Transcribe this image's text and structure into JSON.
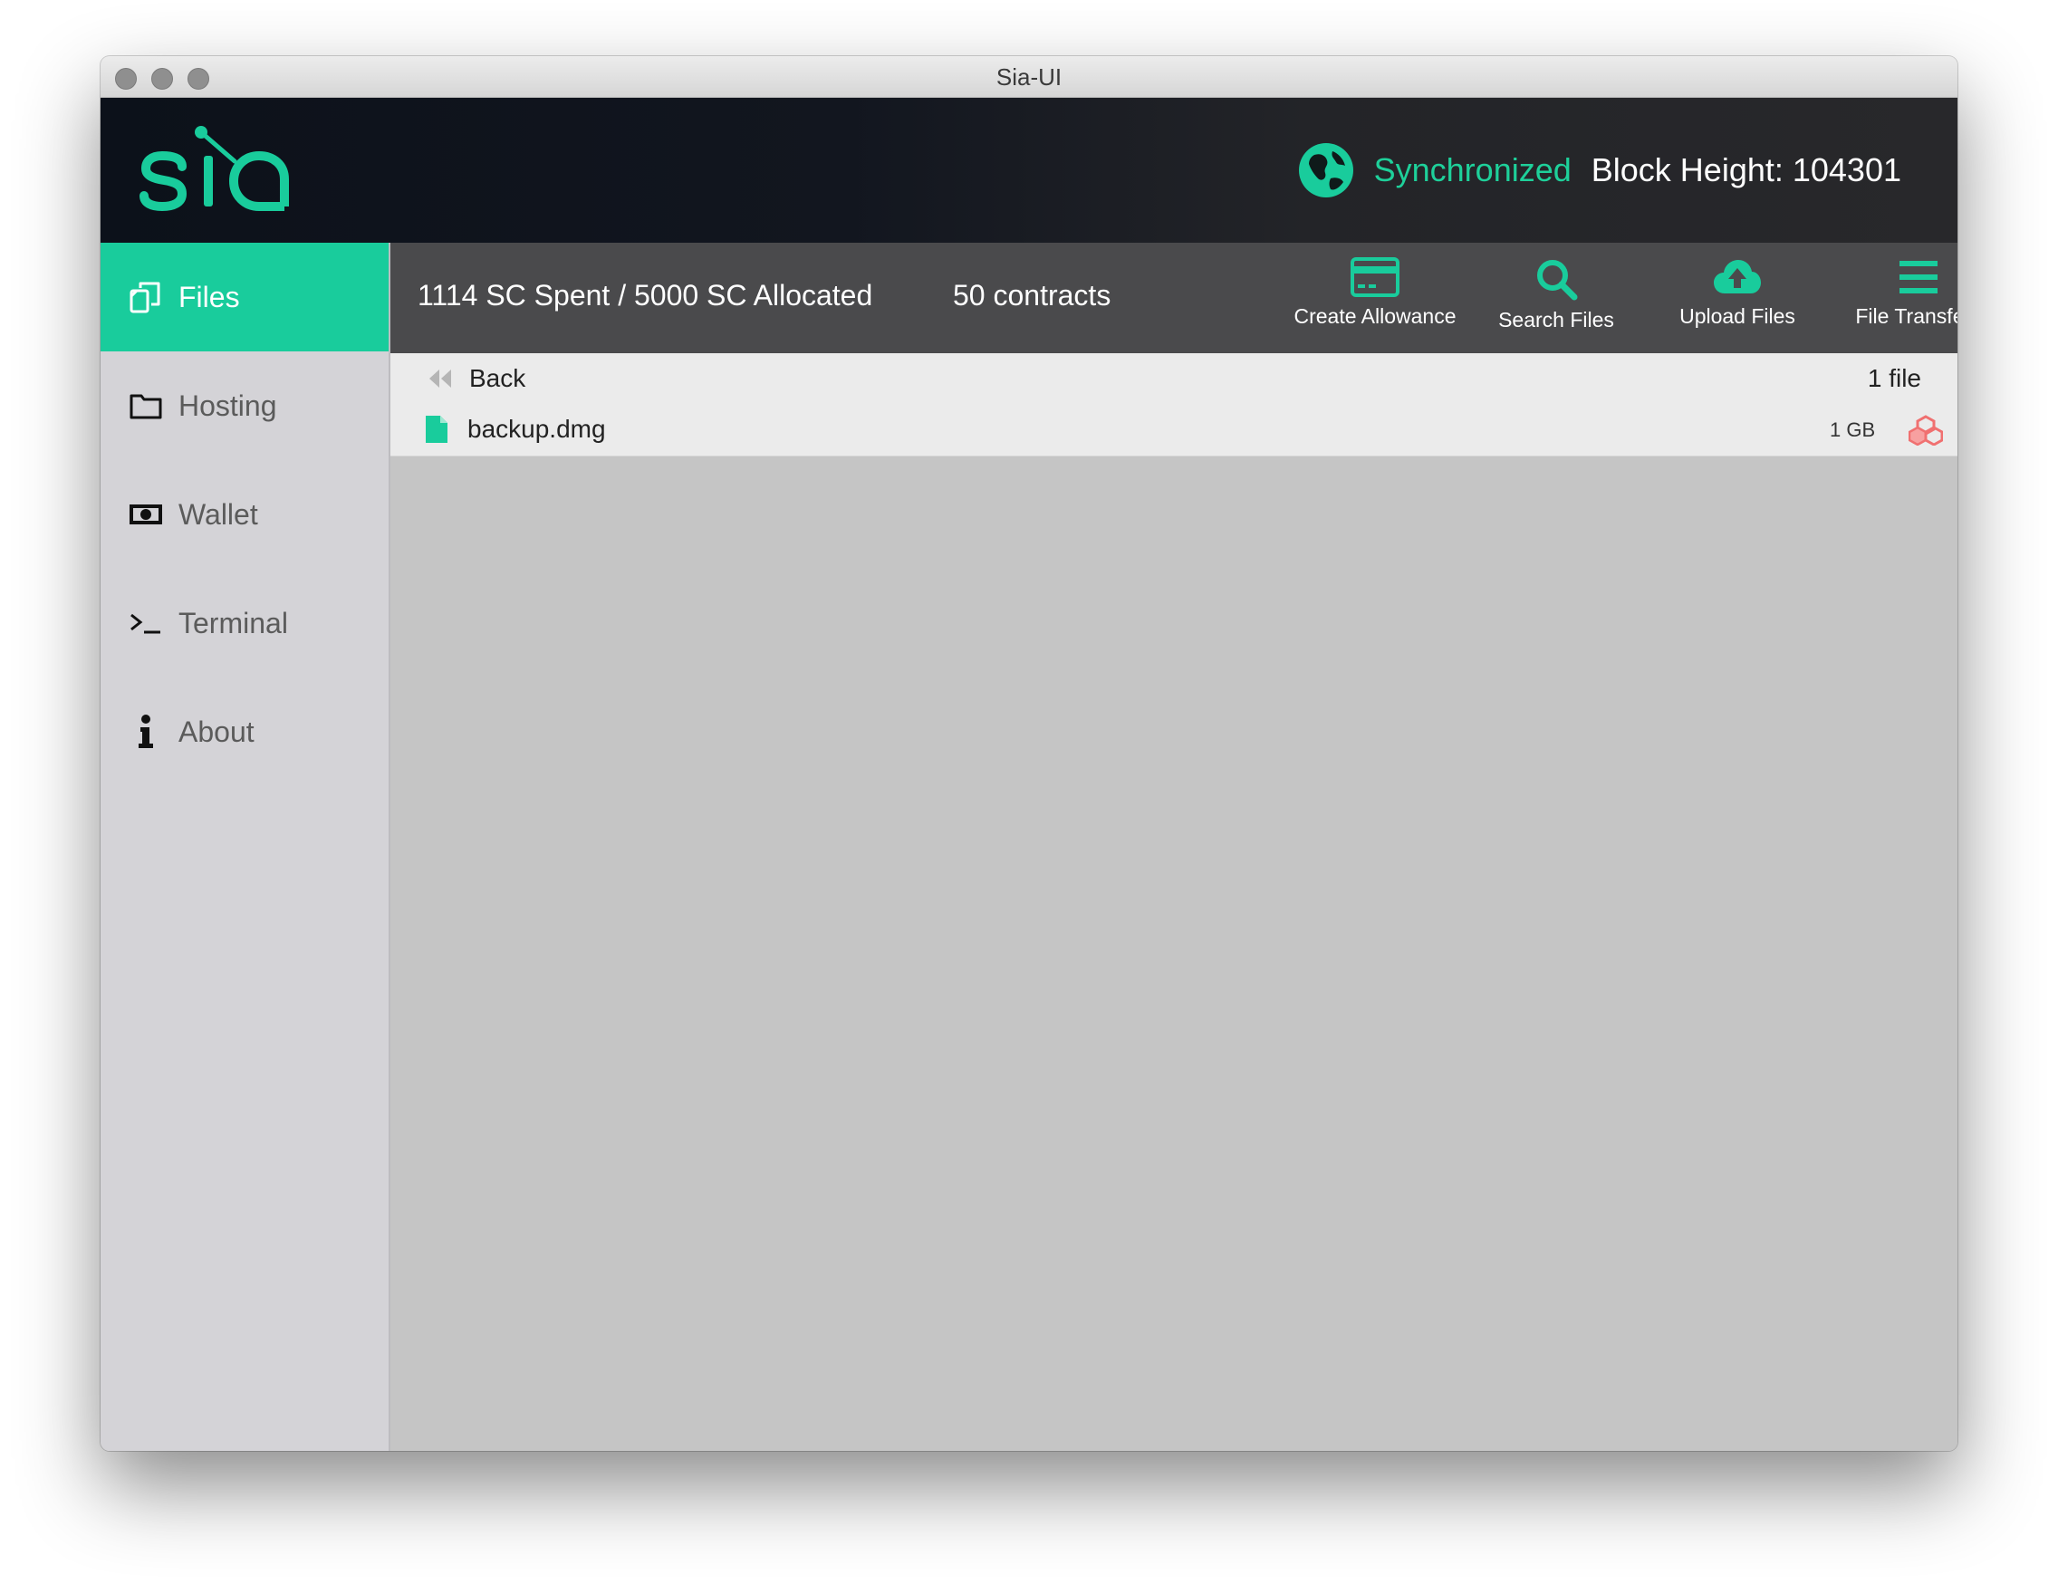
{
  "window": {
    "title": "Sia-UI"
  },
  "header": {
    "logo_text": "sia",
    "sync_status": "Synchronized",
    "block_height": "Block Height: 104301"
  },
  "sidebar": {
    "items": [
      {
        "label": "Files",
        "icon": "files-icon",
        "active": true
      },
      {
        "label": "Hosting",
        "icon": "folder-icon",
        "active": false
      },
      {
        "label": "Wallet",
        "icon": "money-icon",
        "active": false
      },
      {
        "label": "Terminal",
        "icon": "terminal-icon",
        "active": false
      },
      {
        "label": "About",
        "icon": "info-icon",
        "active": false
      }
    ]
  },
  "toolbar": {
    "spent": "1114 SC Spent / 5000 SC Allocated",
    "contracts": "50 contracts",
    "buttons": [
      {
        "label": "Create Allowance",
        "icon": "credit-card-icon"
      },
      {
        "label": "Search Files",
        "icon": "search-icon"
      },
      {
        "label": "Upload Files",
        "icon": "cloud-upload-icon"
      },
      {
        "label": "File Transfers",
        "icon": "list-icon"
      }
    ]
  },
  "files": {
    "back_label": "Back",
    "count": "1 file",
    "rows": [
      {
        "name": "backup.dmg",
        "size": "1 GB",
        "redundancy": "--",
        "icon": "file-icon"
      }
    ]
  },
  "colors": {
    "accent": "#19cc9c",
    "header_dark": "#0c111a",
    "toolbar": "#4a4a4c",
    "sidebar": "#d4d3d7",
    "content": "#c5c5c5",
    "redundancy_warning": "#f07070"
  }
}
